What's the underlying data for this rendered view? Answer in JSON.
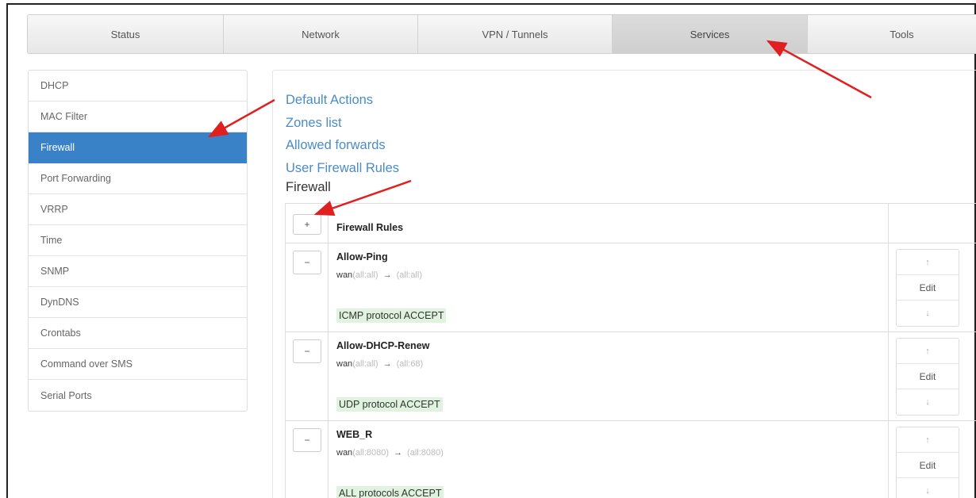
{
  "tabs": [
    {
      "label": "Status"
    },
    {
      "label": "Network"
    },
    {
      "label": "VPN / Tunnels"
    },
    {
      "label": "Services",
      "active": true
    },
    {
      "label": "Tools"
    }
  ],
  "sidebar": {
    "items": [
      {
        "label": "DHCP"
      },
      {
        "label": "MAC Filter"
      },
      {
        "label": "Firewall",
        "active": true
      },
      {
        "label": "Port Forwarding"
      },
      {
        "label": "VRRP"
      },
      {
        "label": "Time"
      },
      {
        "label": "SNMP"
      },
      {
        "label": "DynDNS"
      },
      {
        "label": "Crontabs"
      },
      {
        "label": "Command over SMS"
      },
      {
        "label": "Serial Ports"
      }
    ]
  },
  "main": {
    "links": [
      "Default Actions",
      "Zones list",
      "Allowed forwards",
      "User Firewall Rules"
    ],
    "section_title": "Firewall",
    "table": {
      "add_button": "+",
      "header": "Firewall Rules",
      "remove_button": "−",
      "up_label": "↑",
      "edit_label": "Edit",
      "down_label": "↓",
      "rules": [
        {
          "name": "Allow-Ping",
          "src_zone": "wan",
          "src": "(all:all)",
          "arrow": "→",
          "dst": "(all:all)",
          "action": "ICMP protocol ACCEPT"
        },
        {
          "name": "Allow-DHCP-Renew",
          "src_zone": "wan",
          "src": "(all:all)",
          "arrow": "→",
          "dst": "(all:68)",
          "action": "UDP protocol ACCEPT"
        },
        {
          "name": "WEB_R",
          "src_zone": "wan",
          "src": "(all:8080)",
          "arrow": "→",
          "dst": "(all:8080)",
          "action": "ALL protocols ACCEPT"
        }
      ]
    }
  },
  "colors": {
    "accent": "#3a82c7",
    "link": "#4a8cc8",
    "action_bg": "#dff3df",
    "annotation_arrow": "#e02020"
  }
}
